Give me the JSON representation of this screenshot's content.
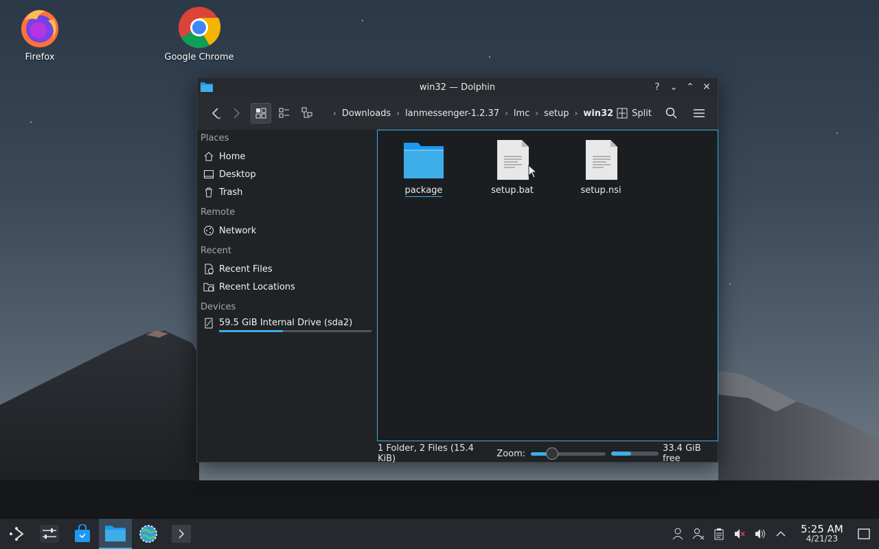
{
  "desktop": {
    "icons": [
      {
        "label": "Firefox"
      },
      {
        "label": "Google Chrome"
      }
    ]
  },
  "window": {
    "title": "win32 — Dolphin",
    "controls": {
      "help": "?",
      "minimize": "⌄",
      "maximize": "⌃",
      "close": "✕"
    }
  },
  "toolbar": {
    "breadcrumbs": [
      "Downloads",
      "lanmessenger-1.2.37",
      "lmc",
      "setup",
      "win32"
    ],
    "split_label": "Split"
  },
  "sidebar": {
    "groups": [
      {
        "title": "Places",
        "items": [
          "Home",
          "Desktop",
          "Trash"
        ]
      },
      {
        "title": "Remote",
        "items": [
          "Network"
        ]
      },
      {
        "title": "Recent",
        "items": [
          "Recent Files",
          "Recent Locations"
        ]
      },
      {
        "title": "Devices",
        "items": [
          "59.5 GiB Internal Drive (sda2)"
        ]
      }
    ],
    "drive_usage_fraction": 0.42
  },
  "files": [
    {
      "name": "package",
      "type": "folder"
    },
    {
      "name": "setup.bat",
      "type": "text"
    },
    {
      "name": "setup.nsi",
      "type": "text"
    }
  ],
  "statusbar": {
    "summary": "1 Folder, 2 Files (15.4 KiB)",
    "zoom_label": "Zoom:",
    "zoom_fraction": 0.28,
    "free_space": "33.4 GiB free",
    "free_usage_fraction": 0.42
  },
  "taskbar": {
    "clock_time": "5:25 AM",
    "clock_date": "4/21/23"
  },
  "colors": {
    "accent": "#3daee9",
    "window_bg": "#202326",
    "content_bg": "#1b1e20"
  }
}
